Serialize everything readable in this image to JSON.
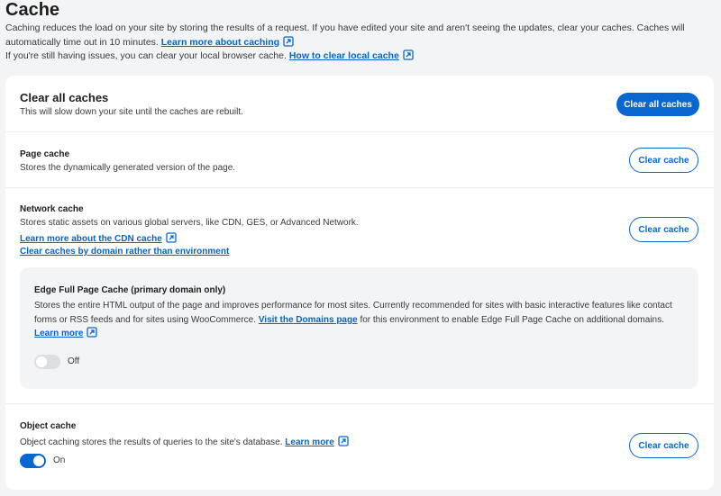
{
  "page": {
    "title": "Cache",
    "intro_line1": "Caching reduces the load on your site by storing the results of a request. If you have edited your site and aren't seeing the updates, clear your caches. Caches will automatically time out in 10 minutes.",
    "intro_link1": "Learn more about caching",
    "intro_line2": "If you're still having issues, you can clear your local browser cache.",
    "intro_link2": "How to clear local cache"
  },
  "sections": {
    "clear_all": {
      "title": "Clear all caches",
      "description": "This will slow down your site until the caches are rebuilt.",
      "button": "Clear all caches"
    },
    "page_cache": {
      "title": "Page cache",
      "description": "Stores the dynamically generated version of the page.",
      "button": "Clear cache"
    },
    "network_cache": {
      "title": "Network cache",
      "description": "Stores static assets on various global servers, like CDN, GES, or Advanced Network.",
      "link1": "Learn more about the CDN cache",
      "link2": "Clear caches by domain rather than environment",
      "button": "Clear cache",
      "edge": {
        "title": "Edge Full Page Cache (primary domain only)",
        "desc_part1": "Stores the entire HTML output of the page and improves performance for most sites. Currently recommended for sites with basic interactive features like contact forms or RSS feeds and for sites using WooCommerce.",
        "domains_link": "Visit the Domains page",
        "desc_part2": "for this environment to enable Edge Full Page Cache on additional domains.",
        "learn_more": "Learn more",
        "toggle_state": "Off"
      }
    },
    "object_cache": {
      "title": "Object cache",
      "description": "Object caching stores the results of queries to the site's database.",
      "learn_more": "Learn more",
      "toggle_state": "On",
      "button": "Clear cache"
    }
  },
  "colors": {
    "accent": "#0a66d1",
    "background": "#f3f4f6",
    "card": "#ffffff"
  }
}
